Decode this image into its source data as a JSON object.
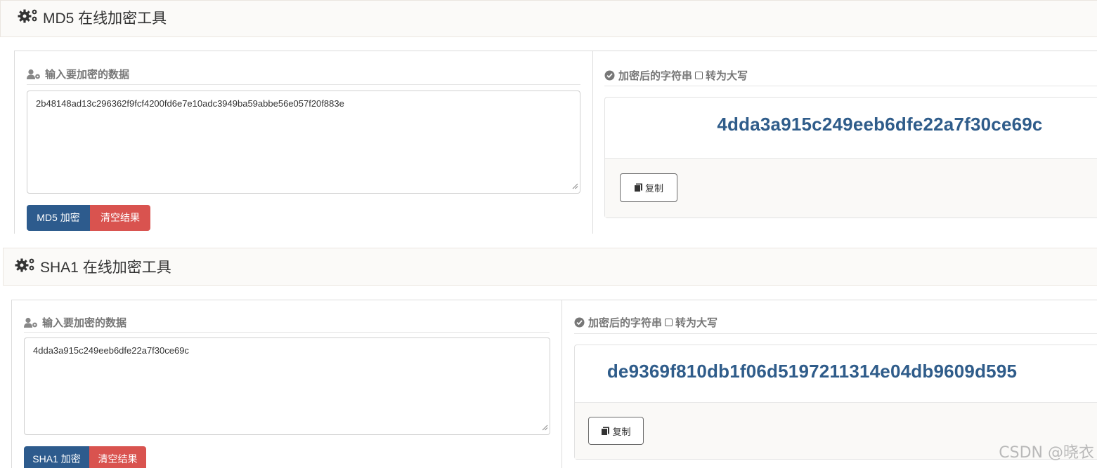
{
  "tools": [
    {
      "title": "MD5 在线加密工具",
      "input_heading": "输入要加密的数据",
      "input_value": "2b48148ad13c296362f9fcf4200fd6e7e10adc3949ba59abbe56e057f20f883e",
      "encrypt_label": "MD5 加密",
      "clear_label": "清空结果",
      "result_heading": "加密后的字符串",
      "uppercase_label": "转为大写",
      "result_hash": "4dda3a915c249eeb6dfe22a7f30ce69c",
      "copy_label": "复制"
    },
    {
      "title": "SHA1 在线加密工具",
      "input_heading": "输入要加密的数据",
      "input_value": "4dda3a915c249eeb6dfe22a7f30ce69c",
      "encrypt_label": "SHA1 加密",
      "clear_label": "清空结果",
      "result_heading": "加密后的字符串",
      "uppercase_label": "转为大写",
      "result_hash": "de9369f810db1f06d5197211314e04db9609d595",
      "copy_label": "复制"
    }
  ],
  "watermark": "CSDN @晓衣",
  "colors": {
    "primary": "#2d5b8d",
    "danger": "#d9534f",
    "hash": "#2f5c8a",
    "heading": "#777777"
  },
  "icons": [
    "gears-icon",
    "user-cog-icon",
    "check-circle-icon",
    "copy-icon",
    "resize-grip-icon"
  ]
}
